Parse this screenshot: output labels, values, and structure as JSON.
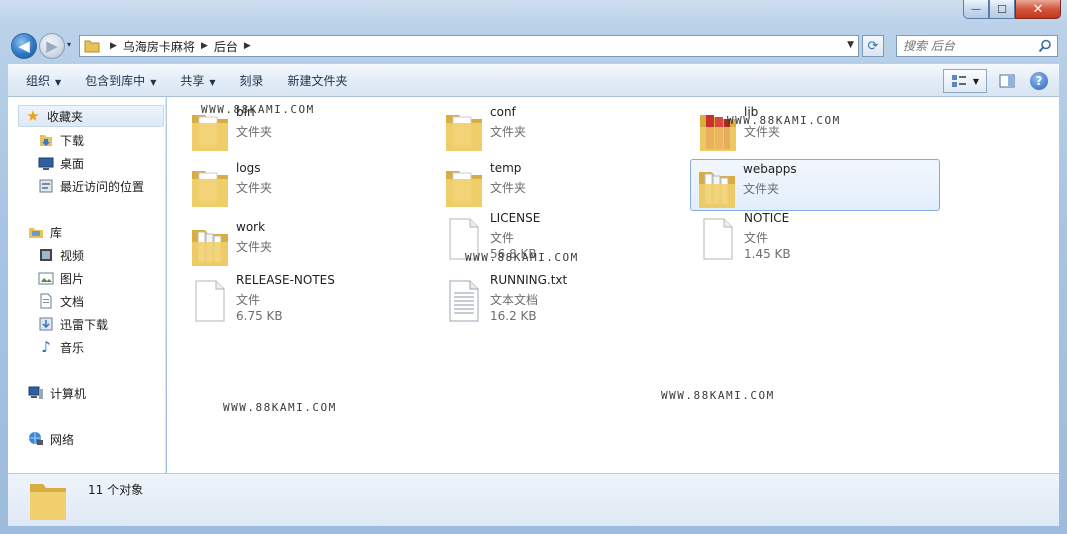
{
  "window": {
    "controls": {
      "minimize": "—",
      "maximize": "☐",
      "close": "✕"
    }
  },
  "address": {
    "crumbs": [
      "乌海房卡麻将",
      "后台"
    ],
    "history_arrow": "▾",
    "dropdown_arrow": "▼"
  },
  "search": {
    "placeholder": "搜索 后台"
  },
  "toolbar": {
    "organize": "组织",
    "include_in_library": "包含到库中",
    "share": "共享",
    "burn": "刻录",
    "new_folder": "新建文件夹"
  },
  "nav": {
    "favorites": "收藏夹",
    "downloads": "下载",
    "desktop": "桌面",
    "recent": "最近访问的位置",
    "libraries": "库",
    "videos": "视频",
    "pictures": "图片",
    "documents": "文档",
    "thunder": "迅雷下载",
    "music": "音乐",
    "computer": "计算机",
    "network": "网络"
  },
  "files": [
    {
      "name": "bin",
      "type": "文件夹",
      "size": "",
      "kind": "folder"
    },
    {
      "name": "conf",
      "type": "文件夹",
      "size": "",
      "kind": "folder"
    },
    {
      "name": "lib",
      "type": "文件夹",
      "size": "",
      "kind": "folder-red"
    },
    {
      "name": "logs",
      "type": "文件夹",
      "size": "",
      "kind": "folder"
    },
    {
      "name": "temp",
      "type": "文件夹",
      "size": "",
      "kind": "folder"
    },
    {
      "name": "webapps",
      "type": "文件夹",
      "size": "",
      "kind": "folder-full"
    },
    {
      "name": "work",
      "type": "文件夹",
      "size": "",
      "kind": "folder-full"
    },
    {
      "name": "LICENSE",
      "type": "文件",
      "size": "56.8 KB",
      "kind": "file"
    },
    {
      "name": "NOTICE",
      "type": "文件",
      "size": "1.45 KB",
      "kind": "file"
    },
    {
      "name": "RELEASE-NOTES",
      "type": "文件",
      "size": "6.75 KB",
      "kind": "file"
    },
    {
      "name": "RUNNING.txt",
      "type": "文本文档",
      "size": "16.2 KB",
      "kind": "text"
    }
  ],
  "watermark": "WWW.88KAMI.COM",
  "status": {
    "count": "11 个对象"
  },
  "colors": {
    "selection_border": "#84acdd",
    "folder_yellow": "#f1cf6c",
    "accent_blue": "#2a64b7"
  }
}
